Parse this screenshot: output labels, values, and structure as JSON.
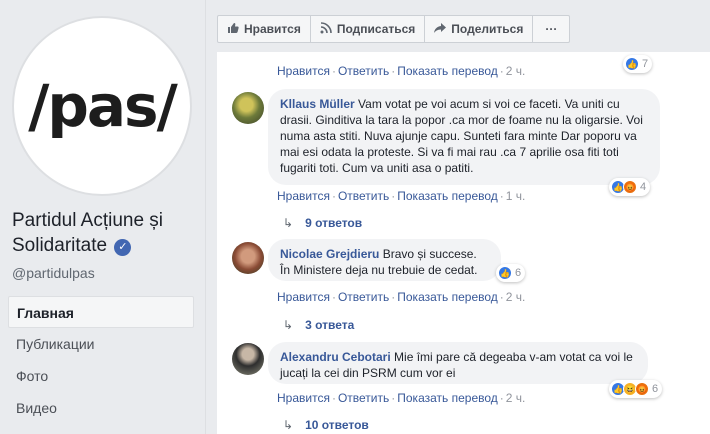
{
  "page": {
    "logo_text": "/pas/",
    "name": "Partidul Acțiune și Solidaritate",
    "handle": "@partidulpas"
  },
  "nav": [
    {
      "label": "Главная",
      "active": true
    },
    {
      "label": "Публикации"
    },
    {
      "label": "Фото"
    },
    {
      "label": "Видео"
    }
  ],
  "toolbar": {
    "like_label": "Нравится",
    "follow_label": "Подписаться",
    "share_label": "Поделиться",
    "more_label": "···"
  },
  "icons": {
    "like": "thumbs-up-icon",
    "follow": "rss-icon",
    "share": "share-arrow-icon",
    "more": "ellipsis-icon",
    "verified": "verified-badge-icon",
    "reply_arrow": "reply-arrow-icon"
  },
  "colors": {
    "link": "#385898",
    "like_blue": "#3578e5",
    "haha_yellow": "#f7b125",
    "angry_orange": "#e9710f"
  },
  "comments": [
    {
      "actions": {
        "like": "Нравится",
        "reply": "Ответить",
        "translate": "Показать перевод",
        "time": "2 ч."
      },
      "reaction_count": "7"
    },
    {
      "author": "Kllaus Müller",
      "text": "Vam votat pe voi acum si voi ce faceti. Va uniti cu drasii. Ginditiva la tara la popor .ca mor de foame nu la oligarsie. Voi numa asta stiti. Nuva ajunje capu. Sunteti fara minte Dar poporu va mai esi odata la proteste. Si va fi mai rau .ca 7 aprilie osa fiti toti fugariti toti. Cum va uniti asa o patiti.",
      "reaction_count": "4",
      "actions": {
        "like": "Нравится",
        "reply": "Ответить",
        "translate": "Показать перевод",
        "time": "1 ч."
      },
      "replies": "9 ответов"
    },
    {
      "author": "Nicolae Grejdieru",
      "text": "Bravo și succese. În Ministere deja nu trebuie de cedat.",
      "reaction_count": "6",
      "actions": {
        "like": "Нравится",
        "reply": "Ответить",
        "translate": "Показать перевод",
        "time": "2 ч."
      },
      "replies": "3 ответа"
    },
    {
      "author": "Alexandru Cebotari",
      "text": "Mie îmi pare că degeaba v-am votat ca voi le jucați la cei din PSRM cum vor ei",
      "reaction_count": "6",
      "actions": {
        "like": "Нравится",
        "reply": "Ответить",
        "translate": "Показать перевод",
        "time": "2 ч."
      },
      "replies": "10 ответов"
    }
  ],
  "separators": {
    "dot": "·"
  },
  "glyphs": {
    "check": "✓",
    "like": "👍",
    "haha": "😆",
    "angry": "😡",
    "reply_arrow": "↳",
    "follow": "◉",
    "share": "➦"
  }
}
